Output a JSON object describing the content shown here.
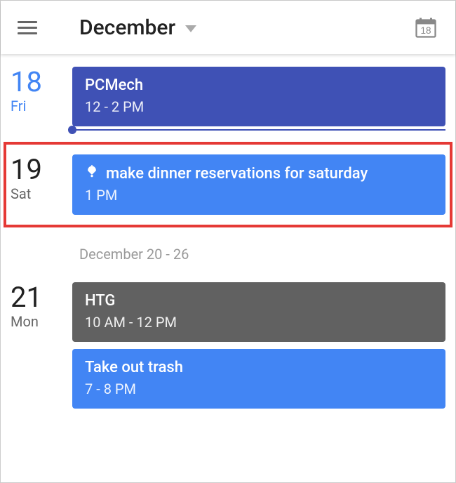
{
  "header": {
    "month_label": "December",
    "today_badge": "18"
  },
  "days": [
    {
      "num": "18",
      "dow": "Fri",
      "is_today": true,
      "events": [
        {
          "title": "PCMech",
          "time": "12 - 2 PM",
          "color": "indigo",
          "has_reminder_icon": false
        }
      ]
    },
    {
      "num": "19",
      "dow": "Sat",
      "is_today": false,
      "highlighted": true,
      "events": [
        {
          "title": "make dinner reservations for saturday",
          "time": "1 PM",
          "color": "blue",
          "has_reminder_icon": true
        }
      ]
    }
  ],
  "week_separator": "December 20 - 26",
  "days2": [
    {
      "num": "21",
      "dow": "Mon",
      "is_today": false,
      "events": [
        {
          "title": "HTG",
          "time": "10 AM - 12 PM",
          "color": "gray",
          "has_reminder_icon": false
        },
        {
          "title": "Take out trash",
          "time": "7 - 8 PM",
          "color": "blue",
          "has_reminder_icon": false
        }
      ]
    }
  ]
}
